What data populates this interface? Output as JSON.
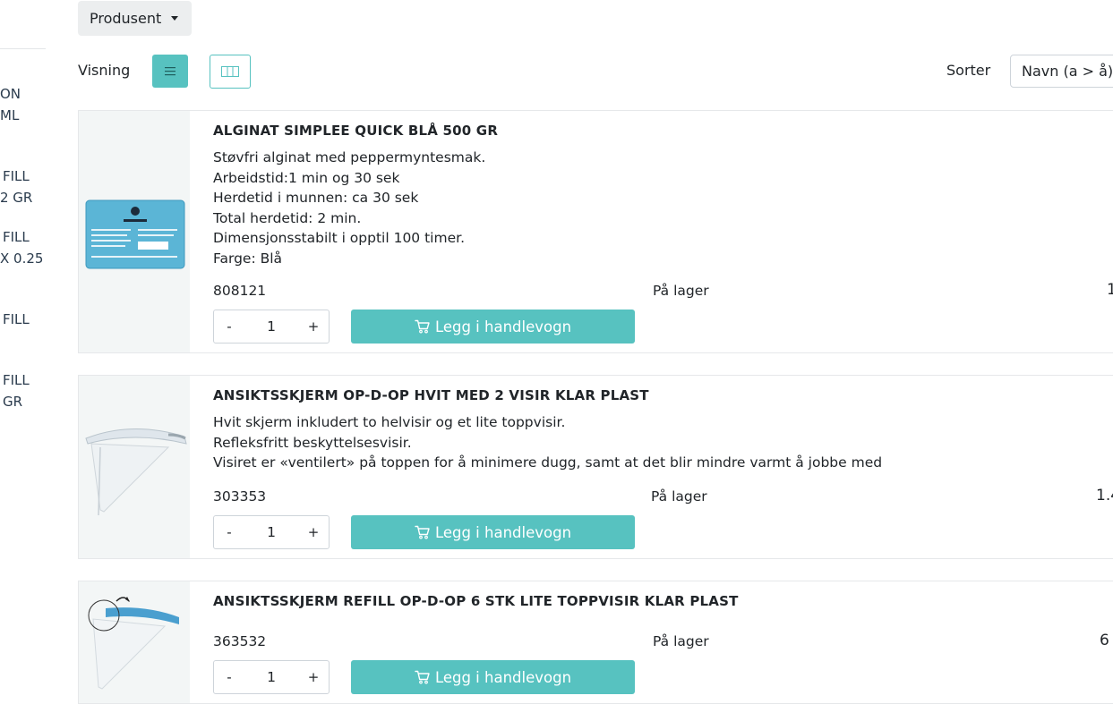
{
  "sidebar": {
    "items": [
      {
        "lines": [
          "ON",
          "ML"
        ]
      },
      {
        "lines": [
          "FILL",
          "2 GR"
        ]
      },
      {
        "lines": [
          "FILL",
          "X 0.25"
        ]
      },
      {
        "lines": [
          "FILL"
        ]
      },
      {
        "lines": [
          "FILL",
          "GR"
        ]
      }
    ]
  },
  "filters": {
    "producer_label": "Produsent"
  },
  "view": {
    "label": "Visning",
    "list_icon": "list-icon",
    "grid_icon": "grid-icon"
  },
  "sort": {
    "label": "Sorter",
    "selected": "Navn (a > å)"
  },
  "colors": {
    "accent": "#57c2c0",
    "text": "#212529",
    "thumb_bg": "#f3f6f6"
  },
  "products": [
    {
      "title": "ALGINAT SIMPLEE QUICK BLÅ 500 GR",
      "description": [
        "Støvfri alginat med peppermyntesmak.",
        "Arbeidstid:1 min og 30 sek",
        "Herdetid i munnen: ca 30 sek",
        "Total herdetid: 2 min.",
        "Dimensjonsstabilt i opptil 100 timer.",
        "Farge: Blå"
      ],
      "sku": "808121",
      "stock": "På lager",
      "price": "1",
      "qty": "1",
      "add_label": "Legg i handlevogn"
    },
    {
      "title": "ANSIKTSSKJERM OP-D-OP HVIT MED 2 VISIR KLAR PLAST",
      "description": [
        "Hvit skjerm inkludert to helvisir og et lite toppvisir.",
        "Refleksfritt beskyttelsesvisir.",
        "Visiret er «ventilert» på toppen for å minimere dugg, samt at det blir mindre varmt å jobbe med"
      ],
      "sku": "303353",
      "stock": "På lager",
      "price": "1.4",
      "qty": "1",
      "add_label": "Legg i handlevogn"
    },
    {
      "title": "ANSIKTSSKJERM REFILL OP-D-OP 6 STK LITE TOPPVISIR KLAR PLAST",
      "description": [],
      "sku": "363532",
      "stock": "På lager",
      "price": "6",
      "qty": "1",
      "add_label": "Legg i handlevogn"
    }
  ],
  "qty_controls": {
    "minus": "-",
    "plus": "+"
  }
}
